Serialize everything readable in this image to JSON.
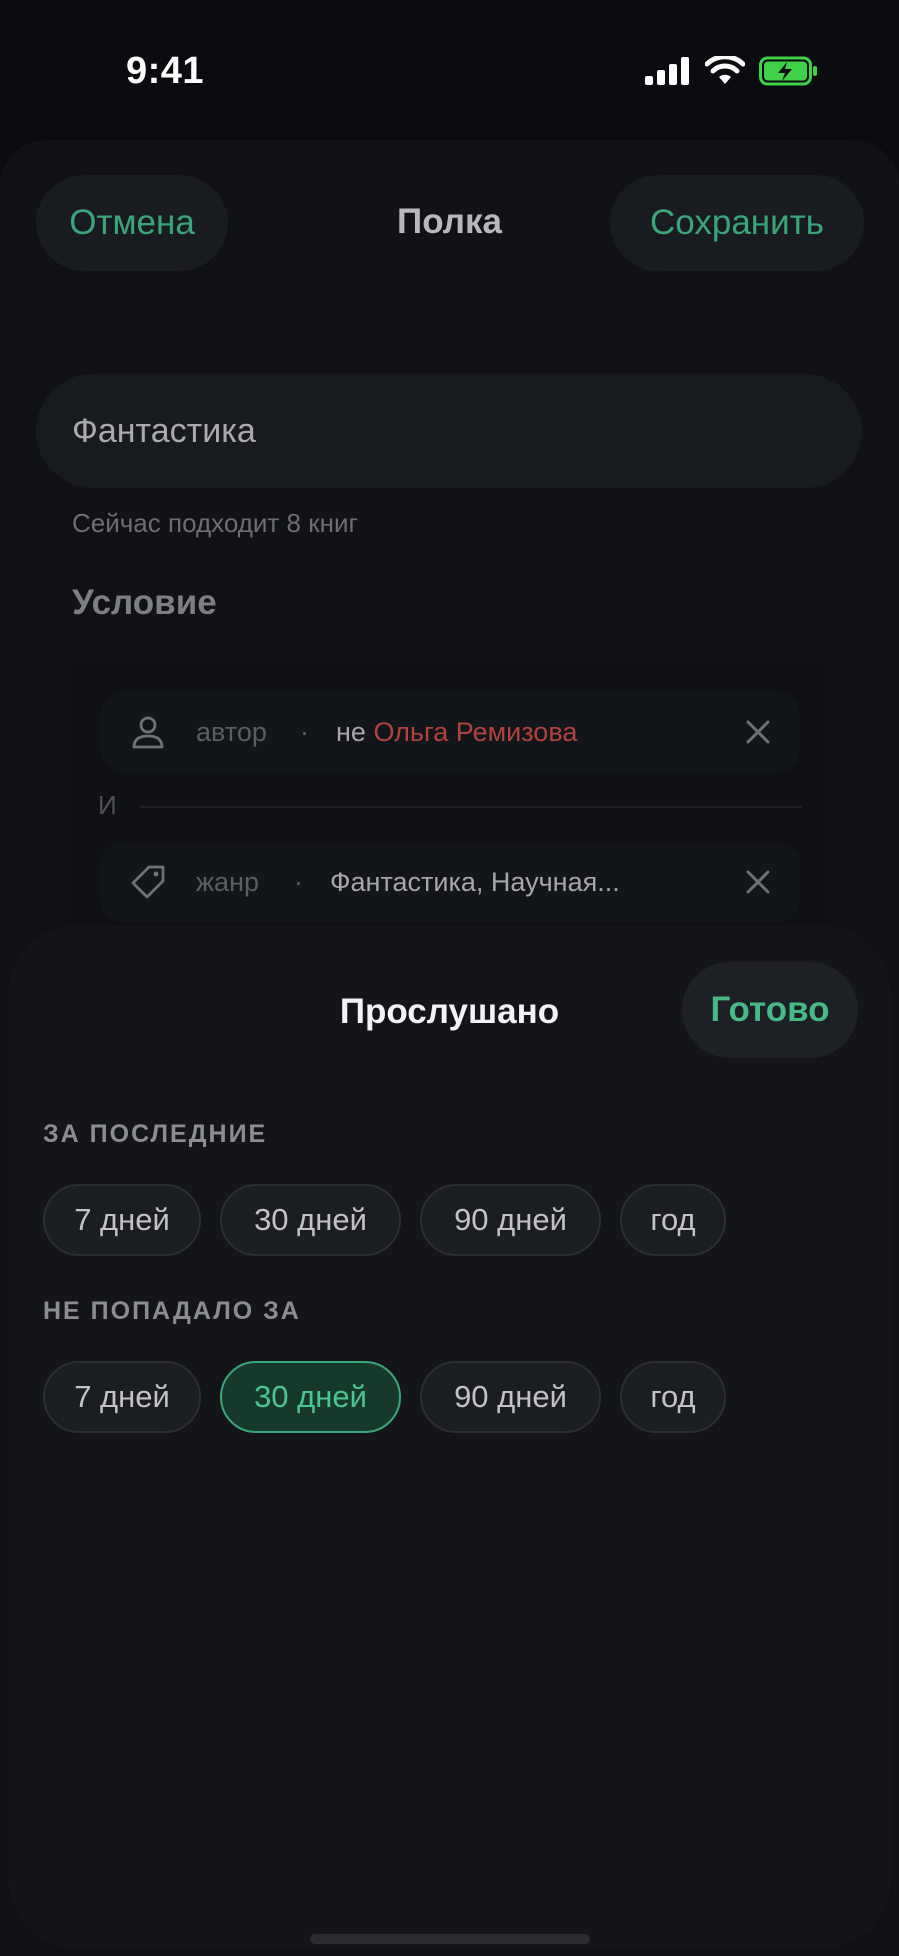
{
  "status_bar": {
    "time": "9:41"
  },
  "editor": {
    "cancel_label": "Отмена",
    "title": "Полка",
    "save_label": "Сохранить",
    "name_value": "Фантастика",
    "match_hint": "Сейчас подходит 8 книг",
    "section_title": "Условие",
    "conditions": [
      {
        "icon": "person-icon",
        "field": "автор",
        "separator": "·",
        "prefix": "не",
        "value": "Ольга Ремизова"
      },
      {
        "icon": "tag-icon",
        "field": "жанр",
        "separator": "·",
        "value": "Фантастика, Научная..."
      }
    ],
    "joiner": "И"
  },
  "sheet": {
    "title": "Прослушано",
    "done_label": "Готово",
    "groups": [
      {
        "label": "ЗА ПОСЛЕДНИЕ",
        "options": [
          "7 дней",
          "30 дней",
          "90 дней",
          "год"
        ],
        "selected": null
      },
      {
        "label": "НЕ ПОПАДАЛО ЗА",
        "options": [
          "7 дней",
          "30 дней",
          "90 дней",
          "год"
        ],
        "selected": "30 дней"
      }
    ]
  },
  "colors": {
    "accent": "#3aa57a",
    "accent_bright": "#47b888",
    "danger": "#b0433e",
    "sheet_bg": "#131518",
    "back_bg": "#101216"
  }
}
